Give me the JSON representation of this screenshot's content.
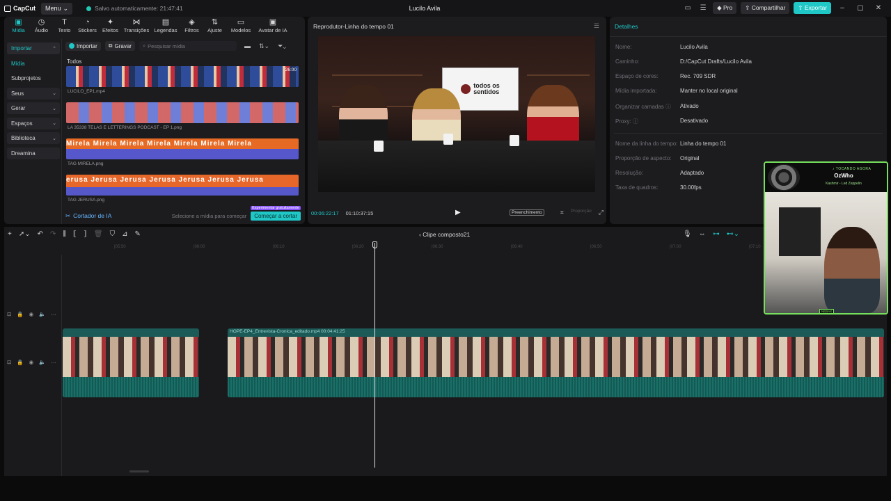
{
  "topbar": {
    "logo": "CapCut",
    "menu_label": "Menu",
    "autosave": "Salvo automaticamente: 21:47:41",
    "project_title": "Lucilo Avila",
    "pro_label": "Pro",
    "share_label": "Compartilhar",
    "export_label": "Exportar"
  },
  "tabs": [
    {
      "label": "Mídia",
      "icon": "media-icon"
    },
    {
      "label": "Áudio",
      "icon": "audio-icon"
    },
    {
      "label": "Texto",
      "icon": "text-icon"
    },
    {
      "label": "Stickers",
      "icon": "sticker-icon"
    },
    {
      "label": "Efeitos",
      "icon": "effects-icon"
    },
    {
      "label": "Transições",
      "icon": "transitions-icon"
    },
    {
      "label": "Legendas",
      "icon": "captions-icon"
    },
    {
      "label": "Filtros",
      "icon": "filters-icon"
    },
    {
      "label": "Ajuste",
      "icon": "adjust-icon"
    },
    {
      "label": "Modelos",
      "icon": "templates-icon"
    },
    {
      "label": "Avatar de IA",
      "icon": "ai-avatar-icon"
    }
  ],
  "left_nav": {
    "import": "Importar",
    "midia": "Mídia",
    "subprojetos": "Subprojetos",
    "seus": "Seus",
    "gerar": "Gerar",
    "espacos": "Espaços",
    "biblioteca": "Biblioteca",
    "dreamina": "Dreamina"
  },
  "media": {
    "import_btn": "Importar",
    "record_btn": "Gravar",
    "search_placeholder": "Pesquisar mídia",
    "section": "Todos",
    "items": [
      {
        "name": "LUCILO_EP1.mp4",
        "duration": "26:00"
      },
      {
        "name": "LA 35338 TELAS E LETTERINGS PODCAST - EP 1.png",
        "duration": ""
      },
      {
        "name": "TAG MIRELA.png",
        "duration": "",
        "overlay": "Mirela"
      },
      {
        "name": "TAG JERUSA.png",
        "duration": "",
        "overlay": "Jerusa"
      }
    ],
    "ai_cutter": "Cortador de IA",
    "select_hint": "Selecione a mídia para começar",
    "start_btn": "Começar a cortar",
    "trial_badge": "Experimentar gratuitamente"
  },
  "player": {
    "title": "Reprodutor-Linha do tempo 01",
    "current_time": "00:06:22:17",
    "total_time": "01:10:37:15",
    "fill_label": "Preenchimento",
    "ratio_label": "Proporção",
    "screen_text_line1": "todos os",
    "screen_text_line2": "sentidos"
  },
  "details": {
    "title": "Detalhes",
    "rows": [
      {
        "label": "Nome:",
        "value": "Lucilo Avila"
      },
      {
        "label": "Caminho:",
        "value": "D:/CapCut Drafts/Lucilo Avila"
      },
      {
        "label": "Espaço de cores:",
        "value": "Rec. 709 SDR"
      },
      {
        "label": "Mídia importada:",
        "value": "Manter no local original"
      },
      {
        "label": "Organizar camadas",
        "value": "Ativado"
      },
      {
        "label": "Proxy:",
        "value": "Desativado"
      },
      {
        "label": "Nome da linha do tempo:",
        "value": "Linha do tempo 01"
      },
      {
        "label": "Proporção de aspecto:",
        "value": "Original"
      },
      {
        "label": "Resolução:",
        "value": "Adaptado"
      },
      {
        "label": "Taxa de quadros:",
        "value": "30.00fps"
      }
    ]
  },
  "timeline": {
    "breadcrumb": "Clipe composto21",
    "ruler": [
      "|05:50",
      "|06:00",
      "|06:10",
      "|06:20",
      "|06:30",
      "|06:40",
      "|06:50",
      "|07:00",
      "|07:10"
    ],
    "clip_name": "HOPE-EP4_Entrevista-Cronica_editado.mp4",
    "clip_duration": "00:04:41:25"
  },
  "webcam": {
    "now_playing_label": "♪ TOCANDO AGORA",
    "song": "OzWho",
    "artist": "Kashmir - Led Zeppelin",
    "tag": "NEBAX"
  },
  "colors": {
    "accent": "#1fc7c7",
    "cam_border": "#75e05c",
    "clip": "#1b5a57"
  }
}
